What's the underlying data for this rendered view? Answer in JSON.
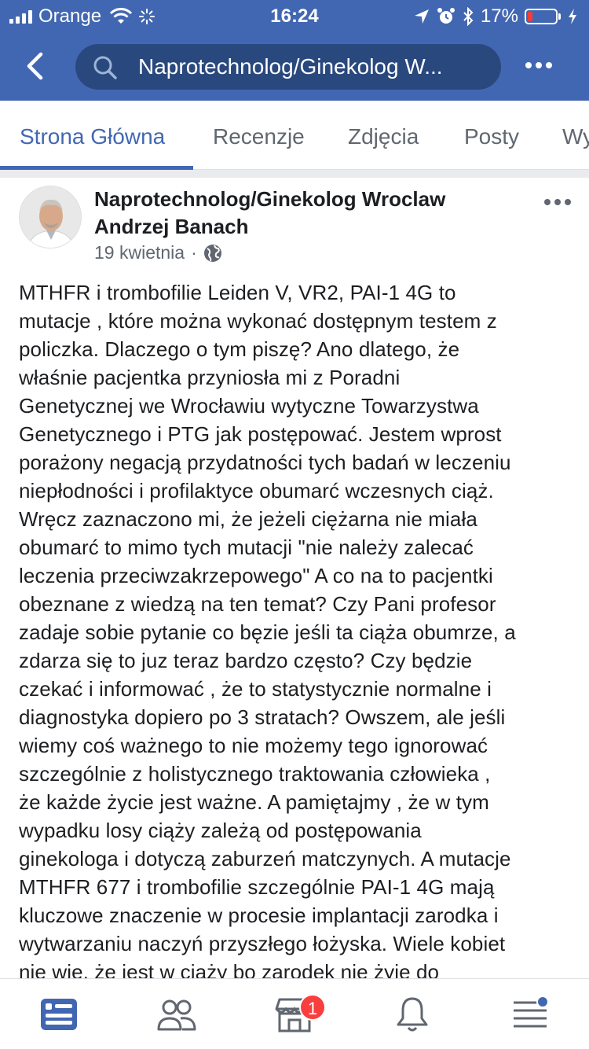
{
  "status_bar": {
    "carrier": "Orange",
    "time": "16:24",
    "battery_percent": "17%",
    "battery_level": 0.17
  },
  "nav": {
    "search_text": "Naprotechnolog/Ginekolog W..."
  },
  "tabs": [
    {
      "label": "Strona Główna",
      "active": true
    },
    {
      "label": "Recenzje",
      "active": false
    },
    {
      "label": "Zdjęcia",
      "active": false
    },
    {
      "label": "Posty",
      "active": false
    },
    {
      "label": "Wy",
      "active": false
    }
  ],
  "post": {
    "author_line1": "Naprotechnolog/Ginekolog Wroclaw",
    "author_line2": "Andrzej Banach",
    "date": "19 kwietnia",
    "separator": "·",
    "lines": [
      "MTHFR i trombofilie Leiden V, VR2, PAI-1 4G to",
      "mutacje , które można wykonać dostępnym testem z",
      "policzka. Dlaczego o tym piszę? Ano dlatego, że",
      "właśnie pacjentka przyniosła mi z Poradni",
      "Genetycznej we Wrocławiu wytyczne Towarzystwa",
      "Genetycznego i PTG jak postępować. Jestem wprost",
      "porażony negacją przydatności tych badań w leczeniu",
      "niepłodności i profilaktyce obumarć wczesnych ciąż.",
      "Wręcz zaznaczono mi, że jeżeli ciężarna nie miała",
      "obumarć to mimo tych mutacji \"nie należy zalecać",
      "leczenia przeciwzakrzepowego\" A co na to pacjentki",
      "obeznane z wiedzą na ten temat? Czy Pani profesor",
      "zadaje sobie pytanie co bęzie jeśli ta ciąża obumrze, a",
      "zdarza się to juz teraz bardzo często? Czy będzie",
      "czekać i informować , że to statystycznie normalne i",
      "diagnostyka dopiero po 3 stratach? Owszem, ale jeśli",
      "wiemy coś ważnego to nie możemy tego ignorować",
      "szczególnie z holistycznego traktowania człowieka ,",
      " że każde życie jest ważne. A pamiętajmy , że w tym",
      "wypadku losy ciąży zależą od postępowania",
      "ginekologa i dotyczą zaburzeń matczynych. A mutacje",
      "MTHFR 677 i trombofilie szczególnie PAI-1 4G mają",
      "kluczowe znaczenie w procesie implantacji zarodka i",
      "wytwarzaniu naczyń przyszłego łożyska. Wiele kobiet",
      "nie wie, że jest w ciąży bo zarodek nie żyje do"
    ]
  },
  "bottom_bar": {
    "marketplace_badge": "1"
  },
  "colors": {
    "brand": "#4267b2",
    "search_bg": "#29487d",
    "badge": "#fa3e3e",
    "battery_low": "#ff3b30"
  },
  "icons": [
    "back-arrow-icon",
    "search-icon",
    "more-icon",
    "globe-icon",
    "news-feed-icon",
    "friends-icon",
    "marketplace-icon",
    "notifications-icon",
    "menu-icon"
  ]
}
